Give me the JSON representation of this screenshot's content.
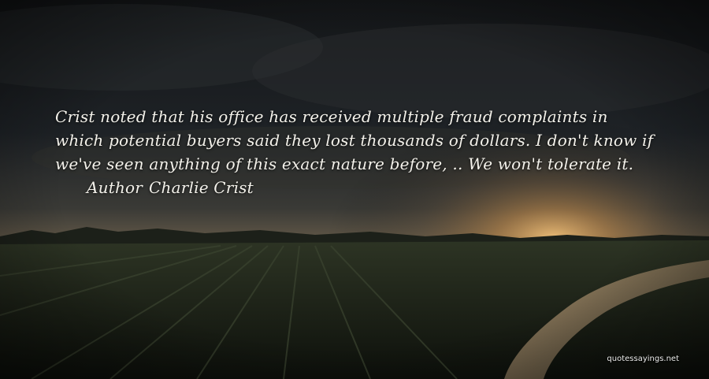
{
  "quote": {
    "lines": [
      "Crist noted that his office has received multiple fraud complaints in",
      "which potential buyers said they lost thousands of dollars. I don't know if",
      "we've seen anything of this exact nature before, .. We won't tolerate it."
    ],
    "author_label": "Author",
    "author_name": "Charlie Crist"
  },
  "watermark": "quotessayings.net",
  "colors": {
    "text": "#f3f1ea",
    "sky_dark": "#15171a",
    "horizon_glow": "#d9a25a",
    "field": "#2a3222"
  }
}
